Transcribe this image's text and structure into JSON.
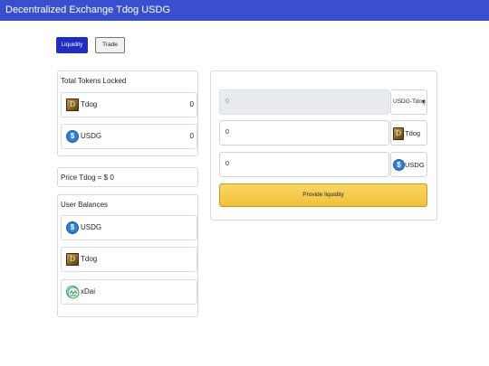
{
  "navbar": {
    "title": "Decentralized Exchange Tdog USDG"
  },
  "tabs": {
    "liquidity": "Liquidity",
    "trade": "Trade"
  },
  "locked": {
    "title": "Total Tokens Locked",
    "items": [
      {
        "name": "Tdog",
        "amount": "0",
        "icon": "tdog-icon"
      },
      {
        "name": "USDG",
        "amount": "0",
        "icon": "usdg-icon"
      }
    ]
  },
  "price": {
    "text": "Price Tdog = $ 0"
  },
  "balances": {
    "title": "User Balances",
    "items": [
      {
        "name": "USDG",
        "icon": "usdg-icon"
      },
      {
        "name": "Tdog",
        "icon": "tdog-icon"
      },
      {
        "name": "xDai",
        "icon": "xdai-icon"
      }
    ]
  },
  "liquidity_form": {
    "lp_value": "0",
    "pair_select": "USDG-Tdog",
    "tdog_value": "0",
    "tdog_label": "Tdog",
    "usdg_value": "0",
    "usdg_label": "USDG",
    "submit_label": "Provide liquidity"
  },
  "icon_glyphs": {
    "tdog": "D",
    "usdg": "$"
  },
  "colors": {
    "navbar": "#3a4fcf",
    "primary_tab": "#1e2ec2",
    "provide_button": "#f2c13a"
  }
}
